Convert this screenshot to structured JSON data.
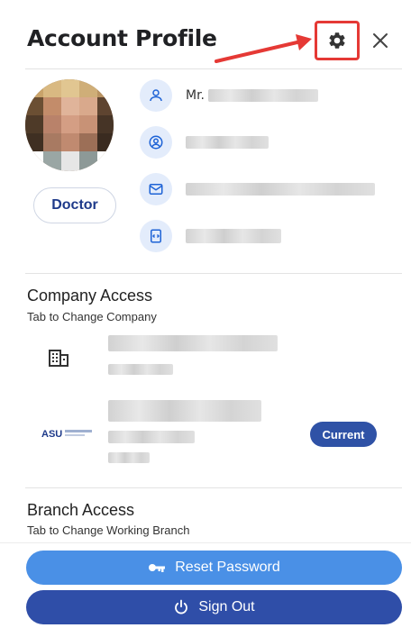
{
  "header": {
    "title": "Account Profile",
    "settings_icon": "gear-icon",
    "close_icon": "close-icon"
  },
  "profile": {
    "role": "Doctor",
    "rows": [
      {
        "icon": "user-icon",
        "prefix": "Mr."
      },
      {
        "icon": "account-circle-icon",
        "prefix": ""
      },
      {
        "icon": "mail-icon",
        "prefix": ""
      },
      {
        "icon": "badge-icon",
        "prefix": ""
      }
    ]
  },
  "company_access": {
    "title": "Company Access",
    "subtitle": "Tab to Change Company",
    "companies": [
      {
        "icon": "building-icon",
        "current": false
      },
      {
        "icon": "company-logo",
        "current": true
      }
    ],
    "current_label": "Current"
  },
  "branch_access": {
    "title": "Branch Access",
    "subtitle": "Tab to Change Working Branch"
  },
  "footer": {
    "reset_password_label": "Reset Password",
    "sign_out_label": "Sign Out"
  },
  "colors": {
    "reset_button": "#4a90e6",
    "sign_out_button": "#2f4ea8",
    "current_badge": "#2f52a6",
    "highlight_box": "#e53935",
    "icon_circle": "#e3ecfb"
  }
}
